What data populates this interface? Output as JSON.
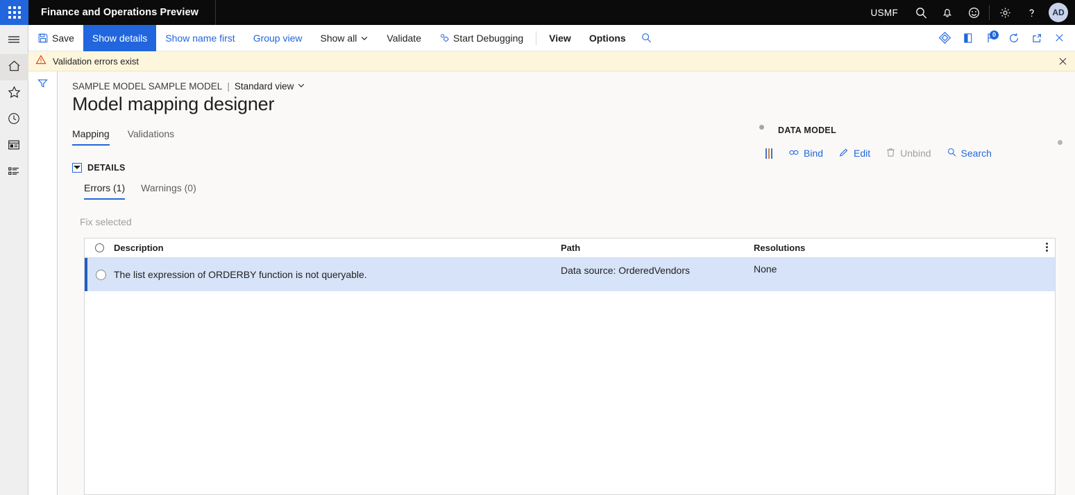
{
  "topbar": {
    "waffle_icon": "app-launcher-icon",
    "app_title": "Finance and Operations Preview",
    "company": "USMF",
    "icons": [
      "search-icon",
      "notifications-bell-icon",
      "feedback-smiley-icon",
      "settings-gear-icon",
      "help-question-icon"
    ],
    "avatar_initials": "AD"
  },
  "navrail": {
    "items": [
      {
        "name": "hamburger-menu",
        "icon": "hamburger-icon"
      },
      {
        "name": "home",
        "icon": "home-icon"
      },
      {
        "name": "favorites",
        "icon": "star-icon"
      },
      {
        "name": "recent",
        "icon": "clock-icon"
      },
      {
        "name": "workspaces",
        "icon": "workspace-icon"
      },
      {
        "name": "modules",
        "icon": "list-icon"
      }
    ]
  },
  "commandbar": {
    "save_label": "Save",
    "show_details_label": "Show details",
    "show_name_first_label": "Show name first",
    "group_view_label": "Group view",
    "show_all_label": "Show all",
    "validate_label": "Validate",
    "start_debugging_label": "Start Debugging",
    "view_label": "View",
    "options_label": "Options",
    "right_icons": [
      {
        "name": "personalize-diamond-icon"
      },
      {
        "name": "panel-book-icon"
      },
      {
        "name": "attachments-flag-icon",
        "badge": "0"
      },
      {
        "name": "refresh-icon"
      },
      {
        "name": "open-in-new-window-icon"
      },
      {
        "name": "close-icon"
      }
    ]
  },
  "messagebar": {
    "icon": "warning-triangle-icon",
    "text": "Validation errors exist",
    "close_icon": "close-icon"
  },
  "filterpanel": {
    "icon": "filter-funnel-icon"
  },
  "page": {
    "breadcrumb_model": "SAMPLE MODEL SAMPLE MODEL",
    "breadcrumb_separator": "|",
    "breadcrumb_view": "Standard view",
    "title": "Model mapping designer",
    "tabs": [
      {
        "label": "Mapping",
        "active": true
      },
      {
        "label": "Validations",
        "active": false
      }
    ],
    "details_section_label": "DETAILS",
    "subtabs": [
      {
        "label": "Errors (1)",
        "active": true
      },
      {
        "label": "Warnings (0)",
        "active": false
      }
    ],
    "fix_selected_label": "Fix selected"
  },
  "datamodel": {
    "title": "DATA MODEL",
    "actions": [
      {
        "label": "Bind",
        "icon": "link-bind-icon",
        "disabled": false
      },
      {
        "label": "Edit",
        "icon": "pencil-edit-icon",
        "disabled": false
      },
      {
        "label": "Unbind",
        "icon": "trash-unbind-icon",
        "disabled": true
      },
      {
        "label": "Search",
        "icon": "search-icon",
        "disabled": false
      }
    ]
  },
  "grid": {
    "columns": [
      "Description",
      "Path",
      "Resolutions"
    ],
    "rows": [
      {
        "description": "The list expression of ORDERBY function is not queryable.",
        "path": "Data source: OrderedVendors",
        "resolutions": "None",
        "selected": true
      }
    ],
    "overflow_menu_icon": "kebab-menu-icon"
  },
  "colors": {
    "accent": "#2266dd",
    "header_bg": "#0b0b0b",
    "selected_row": "#d7e3f8",
    "warning_bg": "#fdf6dd"
  }
}
